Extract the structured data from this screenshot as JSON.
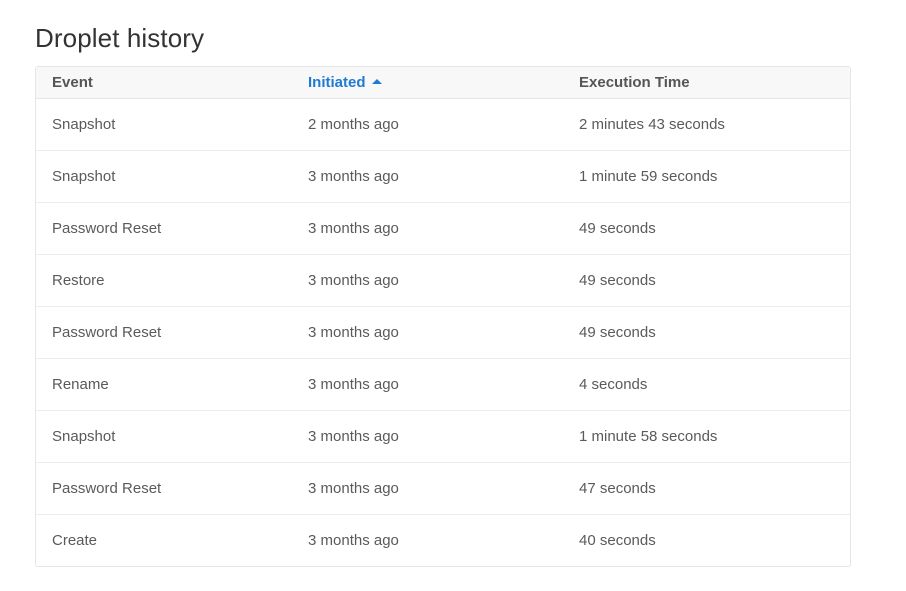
{
  "page": {
    "title": "Droplet history"
  },
  "table": {
    "columns": {
      "event": "Event",
      "initiated": "Initiated",
      "execution_time": "Execution Time"
    },
    "sort": {
      "column": "initiated",
      "direction": "ascending",
      "icon": "sort-up-icon",
      "color": "#1f7ad4"
    },
    "rows": [
      {
        "event": "Snapshot",
        "initiated": "2 months ago",
        "execution_time": "2 minutes 43 seconds"
      },
      {
        "event": "Snapshot",
        "initiated": "3 months ago",
        "execution_time": "1 minute 59 seconds"
      },
      {
        "event": "Password Reset",
        "initiated": "3 months ago",
        "execution_time": "49 seconds"
      },
      {
        "event": "Restore",
        "initiated": "3 months ago",
        "execution_time": "49 seconds"
      },
      {
        "event": "Password Reset",
        "initiated": "3 months ago",
        "execution_time": "49 seconds"
      },
      {
        "event": "Rename",
        "initiated": "3 months ago",
        "execution_time": "4 seconds"
      },
      {
        "event": "Snapshot",
        "initiated": "3 months ago",
        "execution_time": "1 minute 58 seconds"
      },
      {
        "event": "Password Reset",
        "initiated": "3 months ago",
        "execution_time": "47 seconds"
      },
      {
        "event": "Create",
        "initiated": "3 months ago",
        "execution_time": "40 seconds"
      }
    ]
  }
}
